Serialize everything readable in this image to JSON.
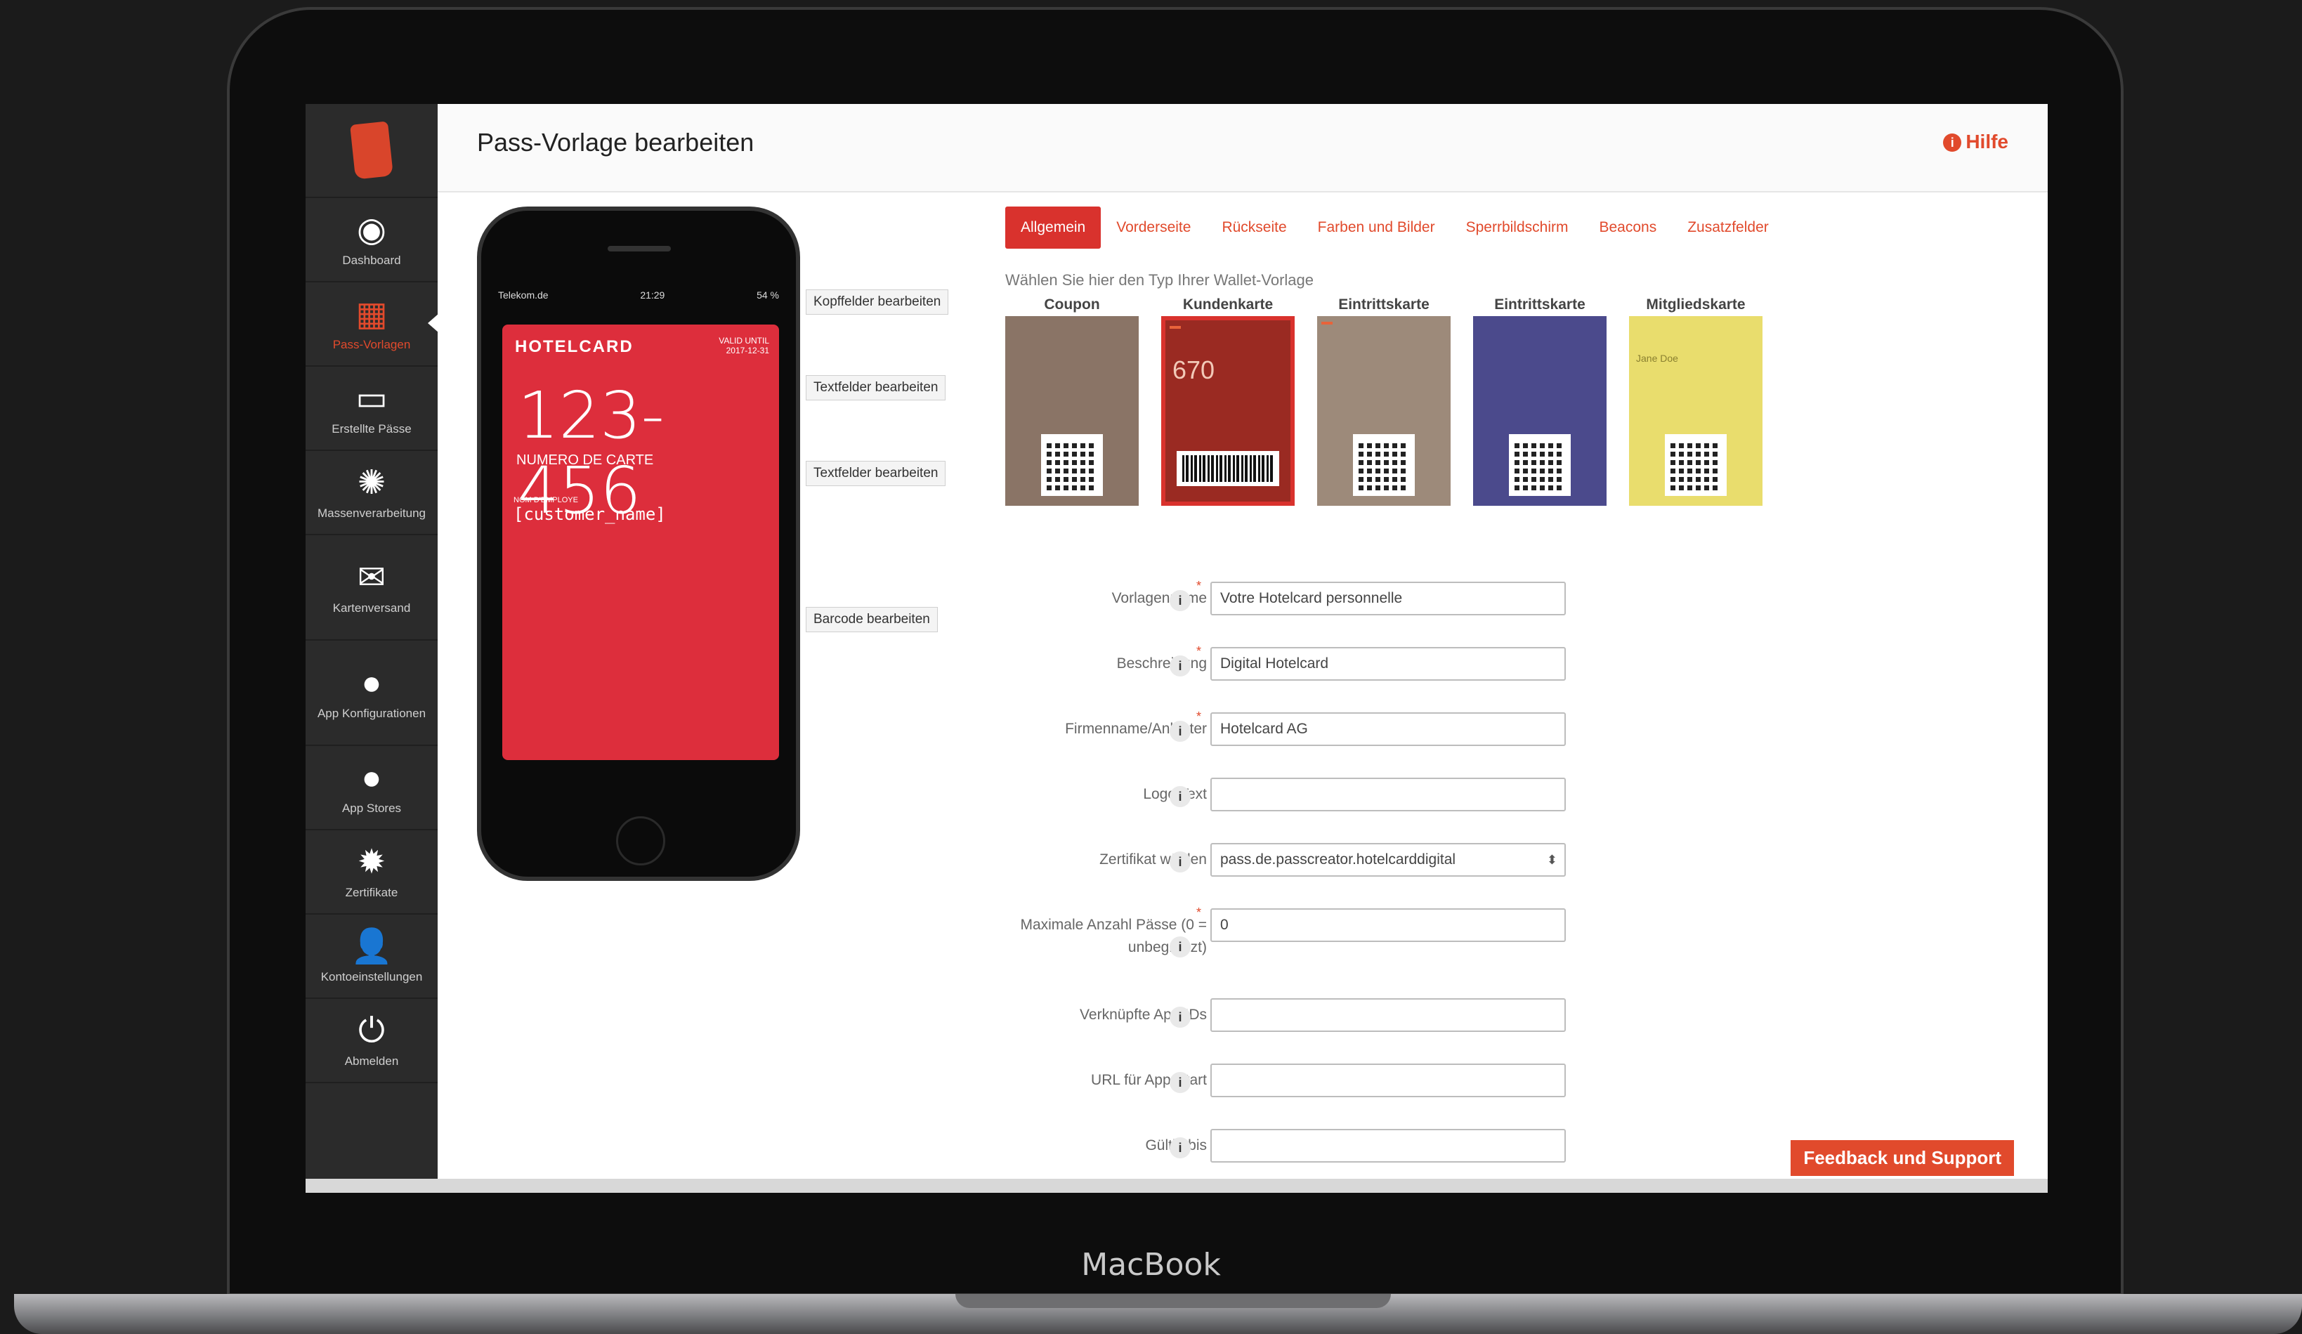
{
  "device": {
    "brand": "MacBook"
  },
  "sidebar": {
    "items": [
      {
        "label": "Dashboard",
        "icon": "dashboard-icon",
        "glyph": "◉"
      },
      {
        "label": "Pass-Vorlagen",
        "icon": "grid-icon",
        "glyph": "▦"
      },
      {
        "label": "Erstellte Pässe",
        "icon": "card-icon",
        "glyph": "▭"
      },
      {
        "label": "Massenverarbeitung",
        "icon": "spinner-icon",
        "glyph": "✺"
      },
      {
        "label": "Kartenversand",
        "icon": "mail-icon",
        "glyph": "✉"
      },
      {
        "label": "App Konfigurationen",
        "icon": "globe-icon",
        "glyph": "●"
      },
      {
        "label": "App Stores",
        "icon": "globe-icon",
        "glyph": "●"
      },
      {
        "label": "Zertifikate",
        "icon": "badge-icon",
        "glyph": "✹"
      },
      {
        "label": "Kontoeinstellungen",
        "icon": "user-icon",
        "glyph": "👤"
      },
      {
        "label": "Abmelden",
        "icon": "power-icon",
        "glyph": "⏻"
      }
    ]
  },
  "header": {
    "title": "Pass-Vorlage bearbeiten",
    "help": "Hilfe",
    "help_glyph": "i"
  },
  "phone": {
    "status_left": "Telekom.de",
    "status_time": "21:29",
    "status_right": "54 %",
    "pass_brand": "HOTELCARD",
    "valid_label": "VALID UNTIL",
    "valid_date": "2017-12-31",
    "number": "123-456",
    "number_label": "NUMERO DE CARTE",
    "field_label": "NOM D'EMPLOYE",
    "field_value": "[customer_name]"
  },
  "callouts": [
    "Kopffelder bearbeiten",
    "Textfelder bearbeiten",
    "Textfelder bearbeiten",
    "Barcode bearbeiten"
  ],
  "tabs": [
    "Allgemein",
    "Vorderseite",
    "Rückseite",
    "Farben und Bilder",
    "Sperrbildschirm",
    "Beacons",
    "Zusatzfelder"
  ],
  "type_selector": {
    "label": "Wählen Sie hier den Typ Ihrer Wallet-Vorlage",
    "types": [
      {
        "name": "Coupon",
        "color": "#8a7466"
      },
      {
        "name": "Kundenkarte",
        "color": "#9a2a22"
      },
      {
        "name": "Eintrittskarte",
        "color": "#9d8a7a"
      },
      {
        "name": "Eintrittskarte",
        "color": "#4b4a8c"
      },
      {
        "name": "Mitgliedskarte",
        "color": "#e9dd6d"
      }
    ],
    "thumb_texts": {
      "kunden_value": "670",
      "mitglied_name": "Jane Doe"
    }
  },
  "form": {
    "fields": [
      {
        "label": "Vorlagenname",
        "value": "Votre Hotelcard personnelle",
        "required": true
      },
      {
        "label": "Beschreibung",
        "value": "Digital Hotelcard",
        "required": true
      },
      {
        "label": "Firmenname/Anbieter",
        "value": "Hotelcard AG",
        "required": true
      },
      {
        "label": "Logo Text",
        "value": "",
        "required": false
      },
      {
        "label": "Zertifikat wählen",
        "value": "pass.de.passcreator.hotelcarddigital",
        "required": false,
        "select": true
      },
      {
        "label": "Maximale Anzahl Pässe (0 = unbegrenzt)",
        "value": "0",
        "required": true
      },
      {
        "label": "Verknüpfte App-IDs",
        "value": "",
        "required": false
      },
      {
        "label": "URL für App-Start",
        "value": "",
        "required": false
      },
      {
        "label": "Gültig bis",
        "value": "",
        "required": false
      }
    ],
    "info_glyph": "i",
    "required_mark": "*"
  },
  "feedback": {
    "label": "Feedback und Support"
  },
  "colors": {
    "accent": "#e14a2c",
    "pass": "#dd2e3c",
    "sidebar": "#2b2b2b"
  }
}
